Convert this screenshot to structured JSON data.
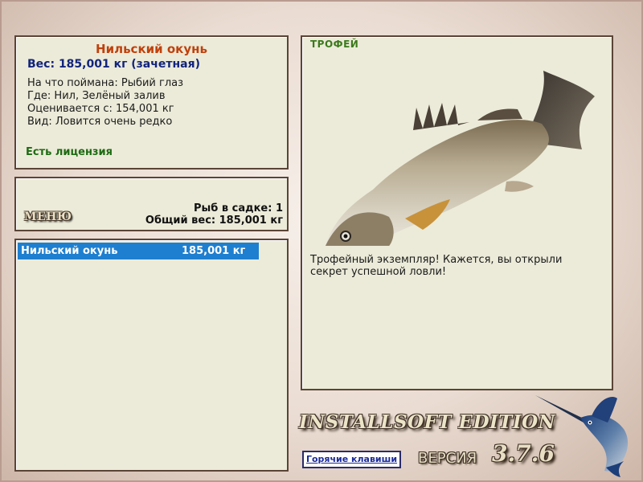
{
  "fish": {
    "name": "Нильский окунь",
    "weight_line": "Вес: 185,001 кг (зачетная)",
    "caught_on": "На что поймана: Рыбий глаз",
    "location": "Где: Нил, Зелёный залив",
    "valued_from": "Оценивается с: 154,001 кг",
    "rarity": "Вид: Ловится очень редко",
    "license": "Есть лицензия"
  },
  "keepnet": {
    "menu_label": "МЕНЮ",
    "count_line": "Рыб в садке: 1",
    "total_weight_line": "Общий вес: 185,001 кг",
    "items": [
      {
        "name": "Нильский окунь",
        "weight": "185,001 кг"
      }
    ]
  },
  "trophy": {
    "label": "ТРОФЕЙ",
    "message": "Трофейный экземпляр! Кажется, вы открыли секрет успешной ловли!"
  },
  "footer": {
    "edition": "INSTALLSOFT EDITION",
    "version_word": "ВЕРСИЯ",
    "version_number": "3.7.6",
    "hotkeys_label": "Горячие клавиши"
  },
  "colors": {
    "fish_name": "#c0410c",
    "weight": "#12247c",
    "license": "#1d6b12",
    "selection": "#1e7fd0",
    "trophy_label": "#3a7a1a"
  }
}
